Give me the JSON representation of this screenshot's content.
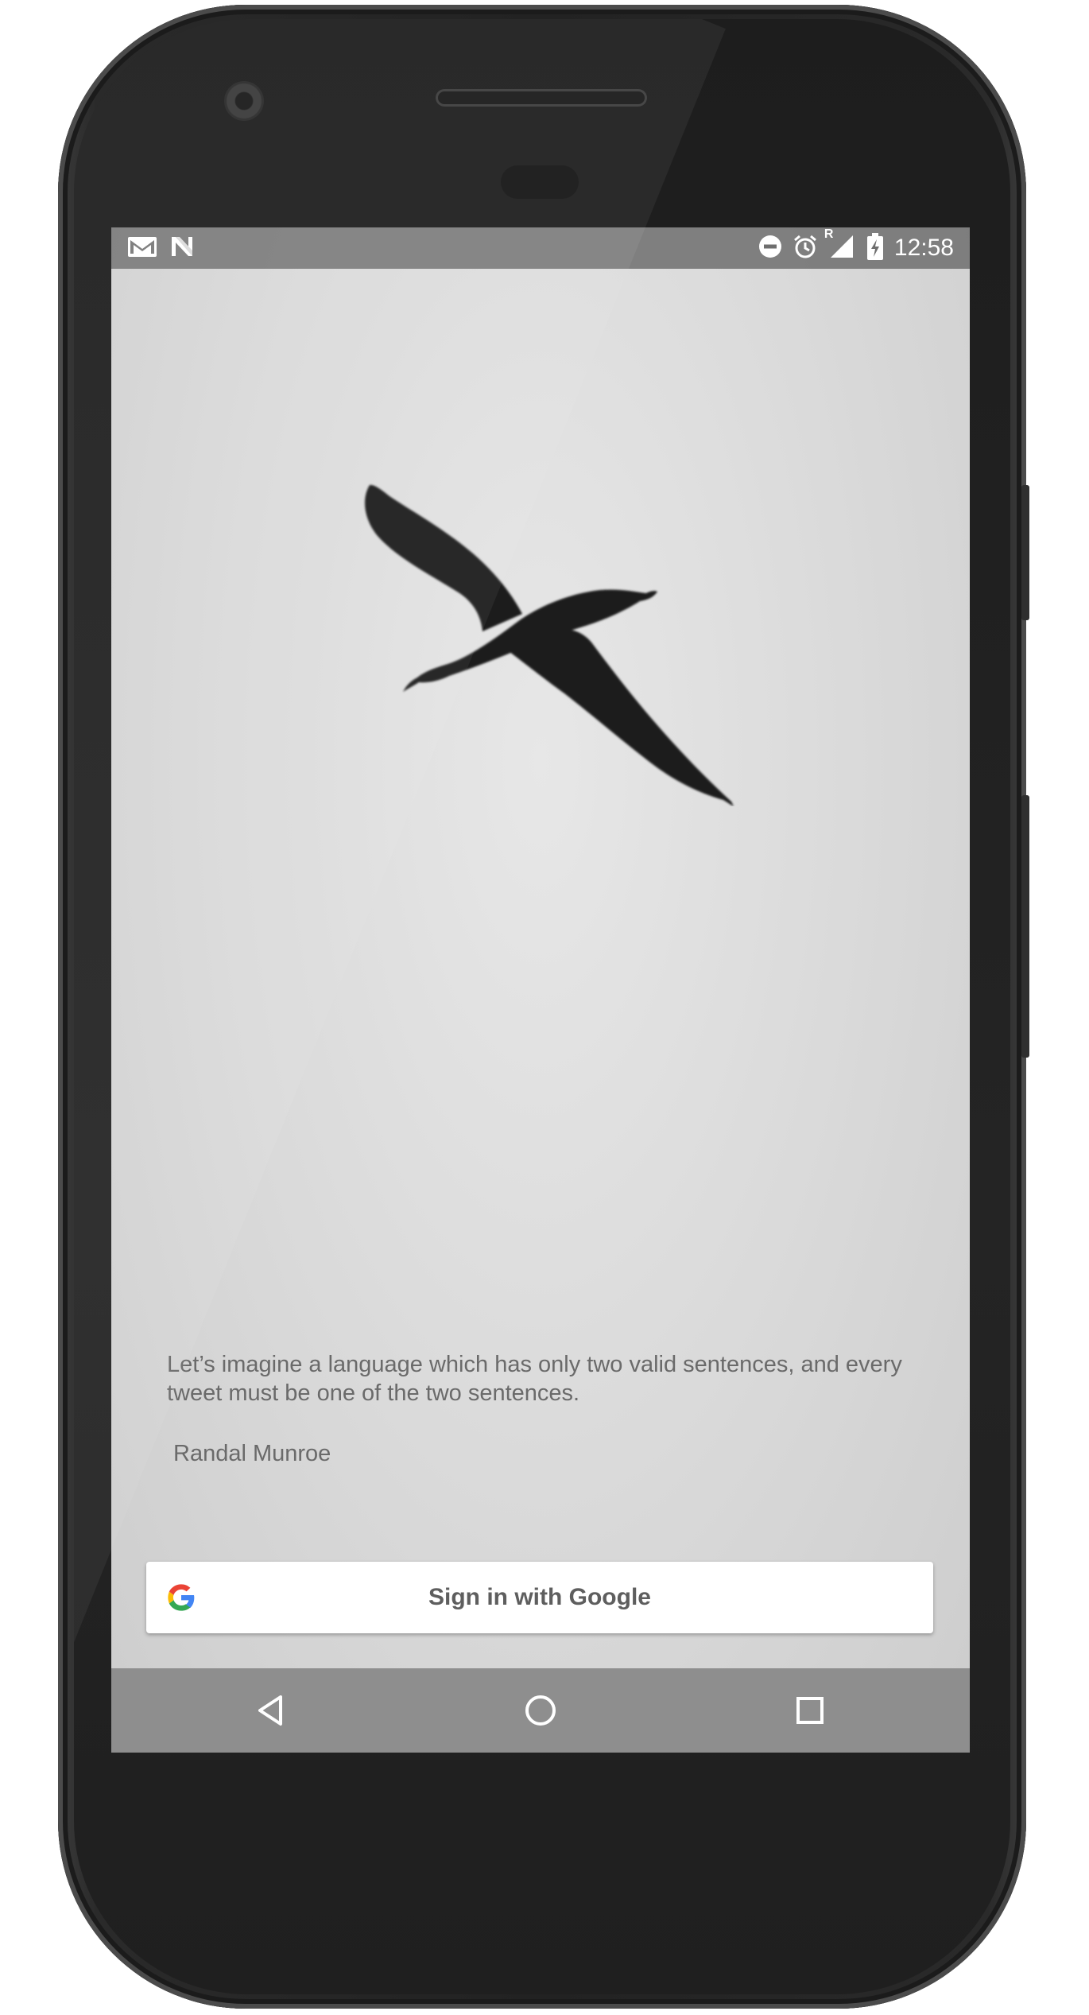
{
  "status_bar": {
    "time": "12:58",
    "left_icons": [
      "gmail-icon",
      "n-icon"
    ],
    "right_icons": [
      "do-not-disturb-icon",
      "alarm-icon",
      "signal-roaming-icon",
      "battery-charging-icon"
    ],
    "roaming_label": "R"
  },
  "hero": {
    "image": "seagull-silhouette"
  },
  "quote": {
    "text": "Let’s imagine a language which has only two valid sentences, and every tweet must be one of the two sentences.",
    "author": "Randal Munroe"
  },
  "signin": {
    "label": "Sign in with Google",
    "icon": "google-g-icon"
  },
  "navigation": {
    "items": [
      "back-icon",
      "home-icon",
      "recents-icon"
    ]
  },
  "colors": {
    "text": "#6a6a6a",
    "button_text": "#5e5e5e",
    "status_bar": "#6e6e6e",
    "nav_bar": "#8e8e8e"
  }
}
